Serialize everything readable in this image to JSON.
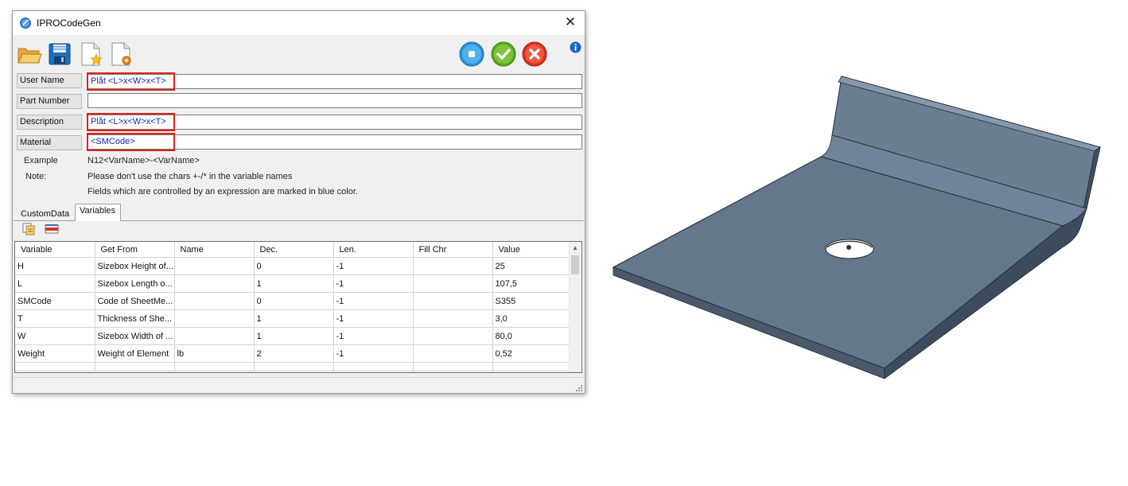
{
  "window": {
    "title": "IPROCodeGen",
    "close_glyph": "✕"
  },
  "toolbar": {
    "icons": [
      "open-folder-icon",
      "save-disk-icon",
      "new-document-star-icon",
      "document-settings-icon"
    ],
    "right_buttons": [
      "reset-circle-icon",
      "confirm-check-icon",
      "cancel-x-icon"
    ],
    "info_icon": "info-icon"
  },
  "fields": [
    {
      "label": "User Name",
      "value": "Plåt <L>x<W>x<T>",
      "highlighted": true
    },
    {
      "label": "Part Number",
      "value": "",
      "highlighted": false
    },
    {
      "label": "Description",
      "value": "Plåt <L>x<W>x<T>",
      "highlighted": true
    },
    {
      "label": "Material",
      "value": "<SMCode>",
      "highlighted": true
    }
  ],
  "info": {
    "example_label": "Example",
    "example_value": "N12<VarName>-<VarName>",
    "note_label": "Note:",
    "note_line1": "Please don't use the chars +-/* in the variable names",
    "note_line2": "Fields which are controlled by an expression are marked in blue color."
  },
  "tabs": [
    {
      "label": "CustomData",
      "active": false
    },
    {
      "label": "Variables",
      "active": true
    }
  ],
  "grid_tools": [
    "copy-rows-icon",
    "delete-row-icon"
  ],
  "table": {
    "columns": [
      "Variable",
      "Get From",
      "Name",
      "Dec.",
      "Len.",
      "Fill Chr",
      "Value"
    ],
    "rows": [
      [
        "H",
        "Sizebox Height of...",
        "",
        "0",
        "-1",
        "",
        "25"
      ],
      [
        "L",
        "Sizebox Length o...",
        "",
        "1",
        "-1",
        "",
        "107,5"
      ],
      [
        "SMCode",
        "Code of SheetMe...",
        "",
        "0",
        "-1",
        "",
        "S355"
      ],
      [
        "T",
        "Thickness of She...",
        "",
        "1",
        "-1",
        "",
        "3,0"
      ],
      [
        "W",
        "Sizebox Width of ...",
        "",
        "1",
        "-1",
        "",
        "80,0"
      ],
      [
        "Weight",
        "Weight of Element",
        "lb",
        "2",
        "-1",
        "",
        "0,52"
      ]
    ]
  },
  "colors": {
    "expression_text": "#1c2aa8",
    "highlight_border": "#e0221b",
    "sheet_metal_top": "#64768a",
    "sheet_metal_edge": "#3c4c5c"
  },
  "model_preview": "sheet-metal-part-3d-view"
}
